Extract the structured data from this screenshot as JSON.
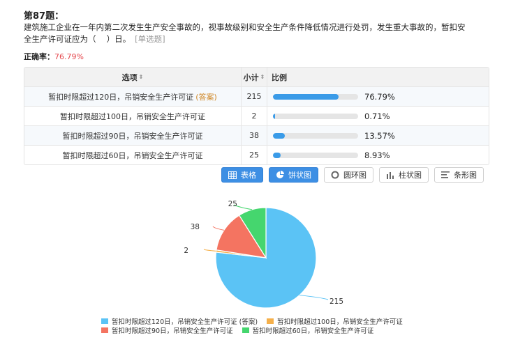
{
  "question": {
    "number_label": "第87题：",
    "text": "建筑施工企业在一年内第二次发生生产安全事故的，视事故级别和安全生产条件降低情况进行处罚，发生重大事故的，暂扣安全生产许可证应为（　 ）日。",
    "type_label": "[单选题]"
  },
  "accuracy": {
    "label": "正确率：",
    "value": "76.79%"
  },
  "table": {
    "headers": {
      "option": "选项",
      "count": "小计",
      "ratio": "比例"
    },
    "rows": [
      {
        "option": "暂扣时限超过120日，吊销安全生产许可证",
        "answer_tag": "(答案)",
        "count": "215",
        "percent": "76.79%",
        "fraction": 0.7679
      },
      {
        "option": "暂扣时限超过100日，吊销安全生产许可证",
        "answer_tag": "",
        "count": "2",
        "percent": "0.71%",
        "fraction": 0.0071
      },
      {
        "option": "暂扣时限超过90日，吊销安全生产许可证",
        "answer_tag": "",
        "count": "38",
        "percent": "13.57%",
        "fraction": 0.1357
      },
      {
        "option": "暂扣时限超过60日，吊销安全生产许可证",
        "answer_tag": "",
        "count": "25",
        "percent": "8.93%",
        "fraction": 0.0893
      }
    ]
  },
  "view_buttons": [
    {
      "label": "表格",
      "icon": "table-icon",
      "active": true
    },
    {
      "label": "饼状图",
      "icon": "pie-icon",
      "active": true
    },
    {
      "label": "圆环图",
      "icon": "donut-icon",
      "active": false
    },
    {
      "label": "柱状图",
      "icon": "bar-chart-icon",
      "active": false
    },
    {
      "label": "条形图",
      "icon": "list-bars-icon",
      "active": false
    }
  ],
  "chart_data": {
    "type": "pie",
    "categories": [
      "暂扣时限超过120日，吊销安全生产许可证 (答案)",
      "暂扣时限超过100日，吊销安全生产许可证",
      "暂扣时限超过90日，吊销安全生产许可证",
      "暂扣时限超过60日，吊销安全生产许可证"
    ],
    "values": [
      215,
      2,
      38,
      25
    ],
    "data_labels": [
      "215",
      "2",
      "38",
      "25"
    ],
    "colors": [
      "#5bc3f5",
      "#f5b04b",
      "#f47461",
      "#45d66e"
    ],
    "legend_position": "bottom"
  }
}
